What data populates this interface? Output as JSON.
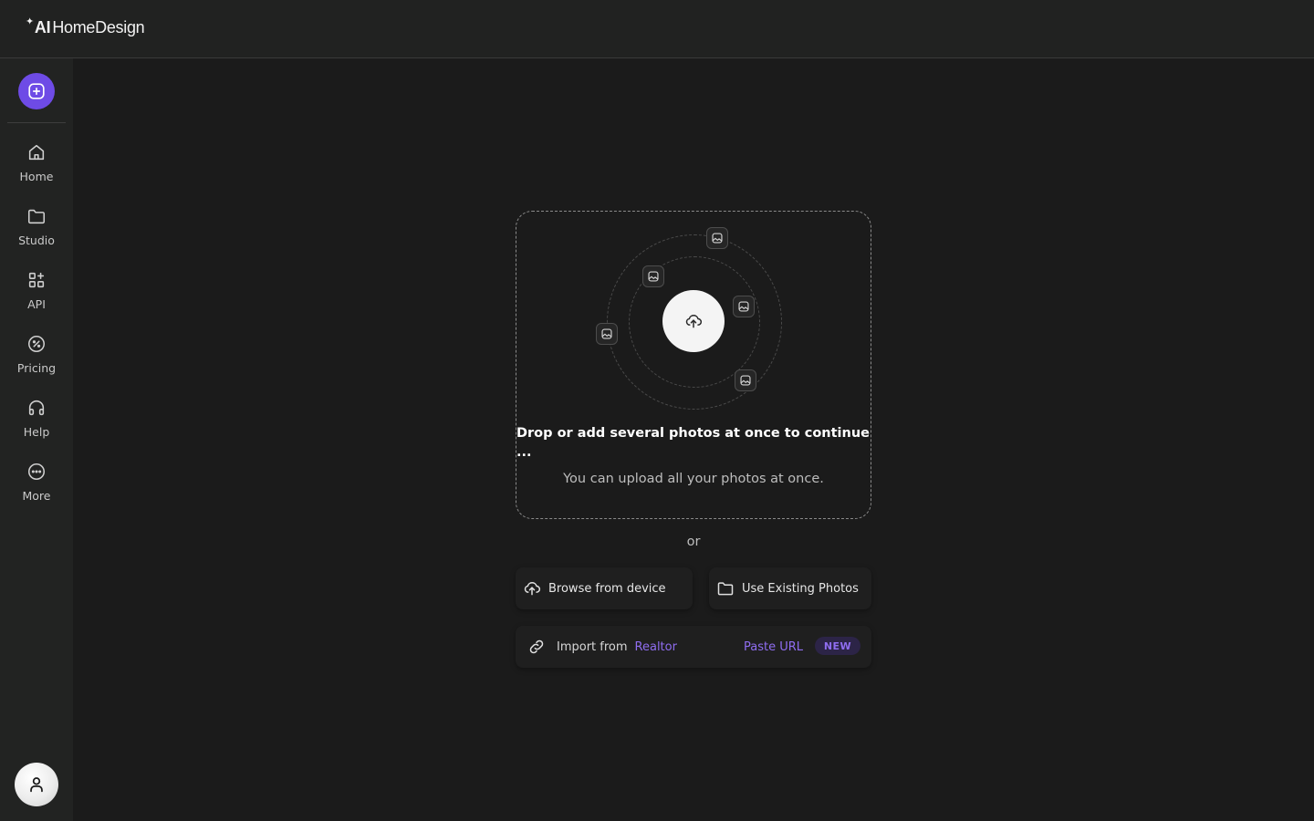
{
  "app": {
    "logo_ai": "AI",
    "logo_text": "HomeDesign"
  },
  "sidebar": {
    "items": [
      {
        "label": "Home",
        "icon": "home-icon"
      },
      {
        "label": "Studio",
        "icon": "folder-icon"
      },
      {
        "label": "API",
        "icon": "grid-plus-icon"
      },
      {
        "label": "Pricing",
        "icon": "percent-icon"
      },
      {
        "label": "Help",
        "icon": "headphones-icon"
      },
      {
        "label": "More",
        "icon": "more-icon"
      }
    ]
  },
  "upload": {
    "title": "Drop or add several photos at once to continue ...",
    "subtitle": "You can upload all your photos at once.",
    "or": "or",
    "browse_label": "Browse from device",
    "existing_label": "Use Existing Photos",
    "import_label": "Import from",
    "import_source": "Realtor",
    "paste_url_label": "Paste URL",
    "new_badge": "NEW"
  },
  "colors": {
    "accent": "#6e4be6",
    "link": "#8f6df0",
    "background": "#1b1b1b",
    "sidebar": "#222322"
  }
}
